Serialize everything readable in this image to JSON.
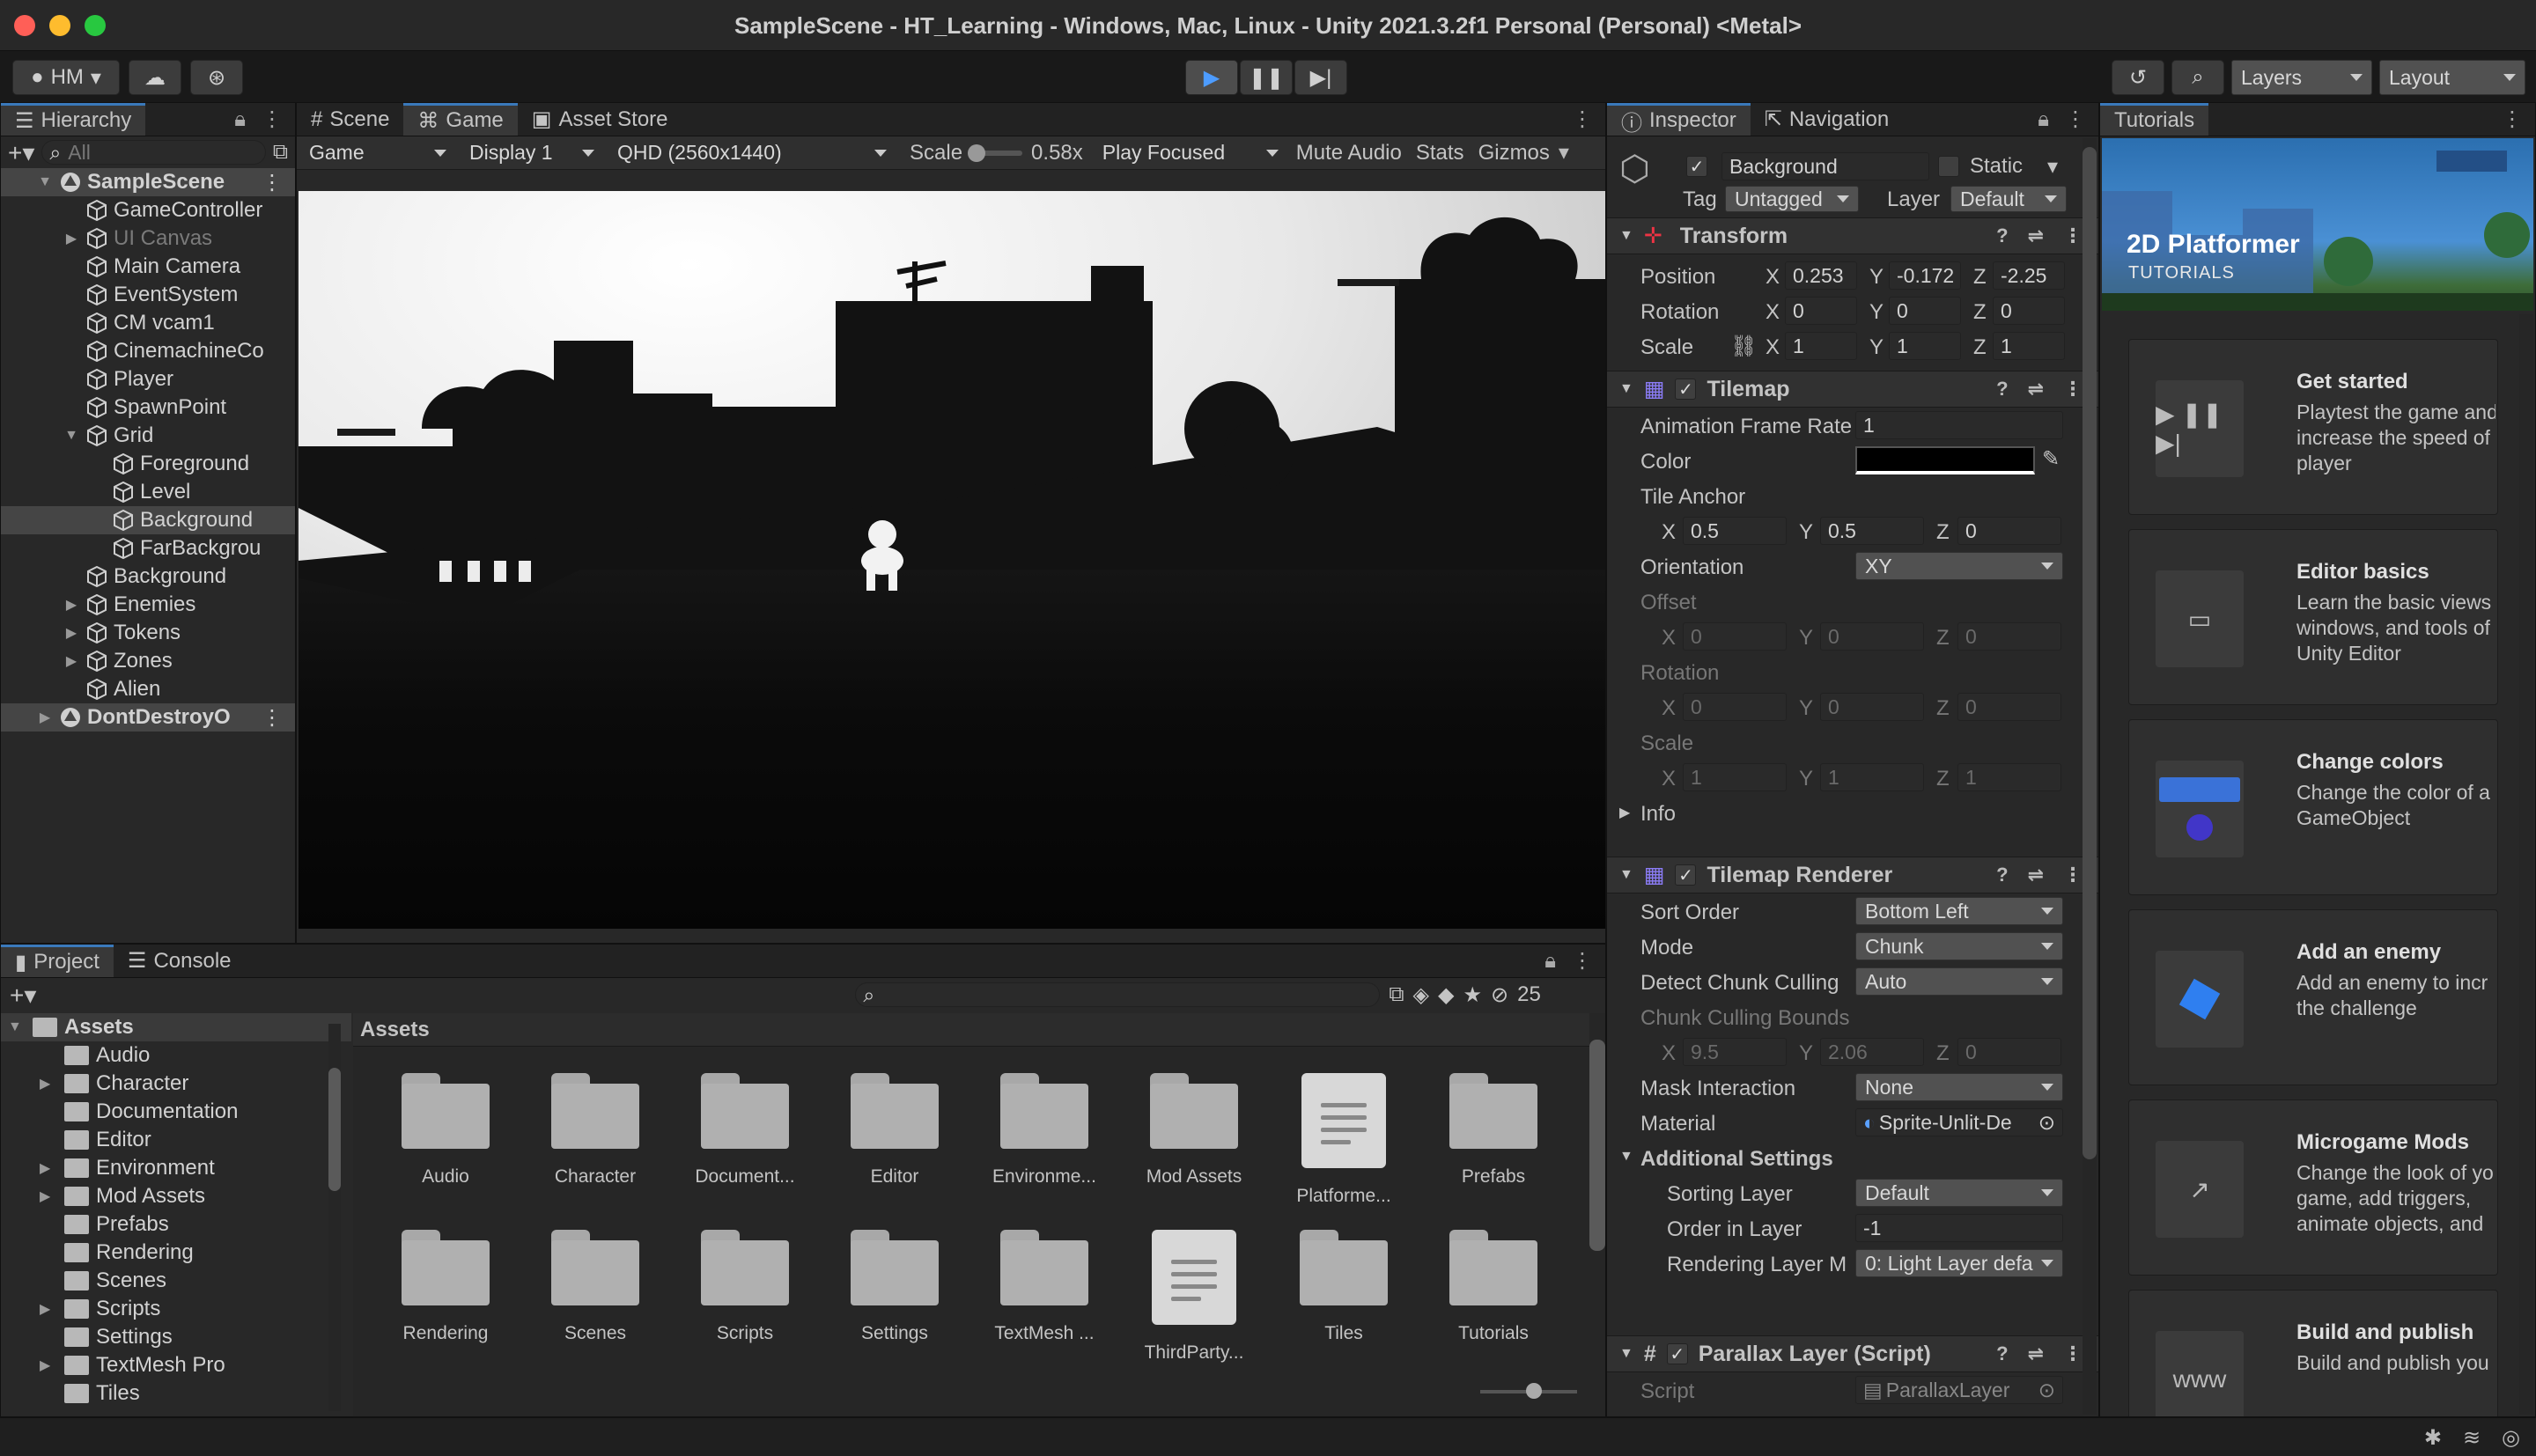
{
  "window": {
    "title": "SampleScene - HT_Learning - Windows, Mac, Linux - Unity 2021.3.2f1 Personal (Personal) <Metal>"
  },
  "toolbar": {
    "account": "HM",
    "layers": "Layers",
    "layout": "Layout"
  },
  "hierarchy": {
    "tab": "Hierarchy",
    "search_placeholder": "All",
    "items": [
      {
        "label": "SampleScene",
        "indent": 0,
        "arrow": "▼",
        "icon": "unity-scene-icon",
        "sel": true
      },
      {
        "label": "GameController",
        "indent": 1,
        "arrow": "",
        "icon": "cube-icon"
      },
      {
        "label": "UI Canvas",
        "indent": 1,
        "arrow": "▶",
        "icon": "cube-icon",
        "dim": true
      },
      {
        "label": "Main Camera",
        "indent": 1,
        "arrow": "",
        "icon": "cube-icon"
      },
      {
        "label": "EventSystem",
        "indent": 1,
        "arrow": "",
        "icon": "cube-icon"
      },
      {
        "label": "CM vcam1",
        "indent": 1,
        "arrow": "",
        "icon": "cube-icon"
      },
      {
        "label": "CinemachineCo",
        "indent": 1,
        "arrow": "",
        "icon": "cube-icon"
      },
      {
        "label": "Player",
        "indent": 1,
        "arrow": "",
        "icon": "cube-icon"
      },
      {
        "label": "SpawnPoint",
        "indent": 1,
        "arrow": "",
        "icon": "cube-icon"
      },
      {
        "label": "Grid",
        "indent": 1,
        "arrow": "▼",
        "icon": "cube-icon"
      },
      {
        "label": "Foreground",
        "indent": 2,
        "arrow": "",
        "icon": "cube-icon"
      },
      {
        "label": "Level",
        "indent": 2,
        "arrow": "",
        "icon": "cube-icon"
      },
      {
        "label": "Background",
        "indent": 2,
        "arrow": "",
        "icon": "cube-icon",
        "sel": true
      },
      {
        "label": "FarBackgrou",
        "indent": 2,
        "arrow": "",
        "icon": "cube-icon"
      },
      {
        "label": "Background",
        "indent": 1,
        "arrow": "",
        "icon": "cube-icon"
      },
      {
        "label": "Enemies",
        "indent": 1,
        "arrow": "▶",
        "icon": "cube-icon"
      },
      {
        "label": "Tokens",
        "indent": 1,
        "arrow": "▶",
        "icon": "cube-icon"
      },
      {
        "label": "Zones",
        "indent": 1,
        "arrow": "▶",
        "icon": "cube-icon"
      },
      {
        "label": "Alien",
        "indent": 1,
        "arrow": "",
        "icon": "cube-icon"
      },
      {
        "label": "DontDestroyO",
        "indent": 0,
        "arrow": "▶",
        "icon": "unity-scene-icon",
        "sel": true
      }
    ]
  },
  "game": {
    "tabs": [
      "Scene",
      "Game",
      "Asset Store"
    ],
    "display_mode": "Game",
    "display": "Display 1",
    "resolution": "QHD (2560x1440)",
    "scale_label": "Scale",
    "scale_value": "0.58x",
    "play_focused": "Play Focused",
    "mute": "Mute Audio",
    "stats": "Stats",
    "gizmos": "Gizmos"
  },
  "inspector": {
    "tabs": [
      "Inspector",
      "Navigation"
    ],
    "object_name": "Background",
    "static": "Static",
    "tag_label": "Tag",
    "tag": "Untagged",
    "layer_label": "Layer",
    "layer": "Default",
    "transform": {
      "title": "Transform",
      "position_label": "Position",
      "rotation_label": "Rotation",
      "scale_label": "Scale",
      "pos": [
        "0.253",
        "-0.172",
        "-2.25"
      ],
      "rot": [
        "0",
        "0",
        "0"
      ],
      "scale": [
        "1",
        "1",
        "1"
      ]
    },
    "tilemap": {
      "title": "Tilemap",
      "anim_label": "Animation Frame Rate",
      "anim": "1",
      "color_label": "Color",
      "anchor_label": "Tile Anchor",
      "anchor": [
        "0.5",
        "0.5",
        "0"
      ],
      "orientation_label": "Orientation",
      "orientation": "XY",
      "offset_label": "Offset",
      "offset": [
        "0",
        "0",
        "0"
      ],
      "rotation_label": "Rotation",
      "rotation": [
        "0",
        "0",
        "0"
      ],
      "scale_label": "Scale",
      "scale": [
        "1",
        "1",
        "1"
      ],
      "info": "Info"
    },
    "renderer": {
      "title": "Tilemap Renderer",
      "sort_label": "Sort Order",
      "sort": "Bottom Left",
      "mode_label": "Mode",
      "mode": "Chunk",
      "detect_label": "Detect Chunk Culling",
      "detect": "Auto",
      "bounds_label": "Chunk Culling Bounds",
      "bounds": [
        "9.5",
        "2.06",
        "0"
      ],
      "mask_label": "Mask Interaction",
      "mask": "None",
      "material_label": "Material",
      "material": "Sprite-Unlit-De",
      "additional": "Additional Settings",
      "sorting_layer_label": "Sorting Layer",
      "sorting_layer": "Default",
      "order_label": "Order in Layer",
      "order": "-1",
      "rlm_label": "Rendering Layer M",
      "rlm": "0: Light Layer defa"
    },
    "parallax": {
      "title": "Parallax Layer (Script)",
      "script_label": "Script",
      "script": "ParallaxLayer"
    }
  },
  "tutorials": {
    "tab": "Tutorials",
    "banner_title": "2D Platformer",
    "banner_sub": "TUTORIALS",
    "cards": [
      {
        "title": "Get started",
        "desc": [
          "Playtest the game and",
          "increase the speed of",
          "player"
        ]
      },
      {
        "title": "Editor basics",
        "desc": [
          "Learn the basic views",
          "windows, and tools of",
          "Unity Editor"
        ]
      },
      {
        "title": "Change colors",
        "desc": [
          "Change the color of a",
          "GameObject"
        ]
      },
      {
        "title": "Add an enemy",
        "desc": [
          "Add an enemy to incr",
          "the challenge"
        ]
      },
      {
        "title": "Microgame Mods",
        "desc": [
          "Change the look of yo",
          "game, add triggers,",
          "animate objects, and"
        ]
      },
      {
        "title": "Build and publish",
        "desc": [
          "Build and publish you"
        ]
      }
    ]
  },
  "project": {
    "tabs": [
      "Project",
      "Console"
    ],
    "hidden_count": "25",
    "breadcrumb": "Assets",
    "tree": [
      {
        "label": "Assets",
        "indent": 0,
        "arrow": "▼"
      },
      {
        "label": "Audio",
        "indent": 1,
        "arrow": ""
      },
      {
        "label": "Character",
        "indent": 1,
        "arrow": "▶"
      },
      {
        "label": "Documentation",
        "indent": 1,
        "arrow": ""
      },
      {
        "label": "Editor",
        "indent": 1,
        "arrow": ""
      },
      {
        "label": "Environment",
        "indent": 1,
        "arrow": "▶"
      },
      {
        "label": "Mod Assets",
        "indent": 1,
        "arrow": "▶"
      },
      {
        "label": "Prefabs",
        "indent": 1,
        "arrow": ""
      },
      {
        "label": "Rendering",
        "indent": 1,
        "arrow": ""
      },
      {
        "label": "Scenes",
        "indent": 1,
        "arrow": ""
      },
      {
        "label": "Scripts",
        "indent": 1,
        "arrow": "▶"
      },
      {
        "label": "Settings",
        "indent": 1,
        "arrow": ""
      },
      {
        "label": "TextMesh Pro",
        "indent": 1,
        "arrow": "▶"
      },
      {
        "label": "Tiles",
        "indent": 1,
        "arrow": ""
      }
    ],
    "assets": [
      {
        "label": "Audio",
        "kind": "folder"
      },
      {
        "label": "Character",
        "kind": "folder"
      },
      {
        "label": "Document...",
        "kind": "folder"
      },
      {
        "label": "Editor",
        "kind": "folder"
      },
      {
        "label": "Environme...",
        "kind": "folder"
      },
      {
        "label": "Mod Assets",
        "kind": "folder"
      },
      {
        "label": "Platforme...",
        "kind": "doc"
      },
      {
        "label": "Prefabs",
        "kind": "folder"
      },
      {
        "label": "Rendering",
        "kind": "folder"
      },
      {
        "label": "Scenes",
        "kind": "folder"
      },
      {
        "label": "Scripts",
        "kind": "folder"
      },
      {
        "label": "Settings",
        "kind": "folder"
      },
      {
        "label": "TextMesh ...",
        "kind": "folder"
      },
      {
        "label": "ThirdParty...",
        "kind": "doc"
      },
      {
        "label": "Tiles",
        "kind": "folder"
      },
      {
        "label": "Tutorials",
        "kind": "folder"
      }
    ]
  }
}
